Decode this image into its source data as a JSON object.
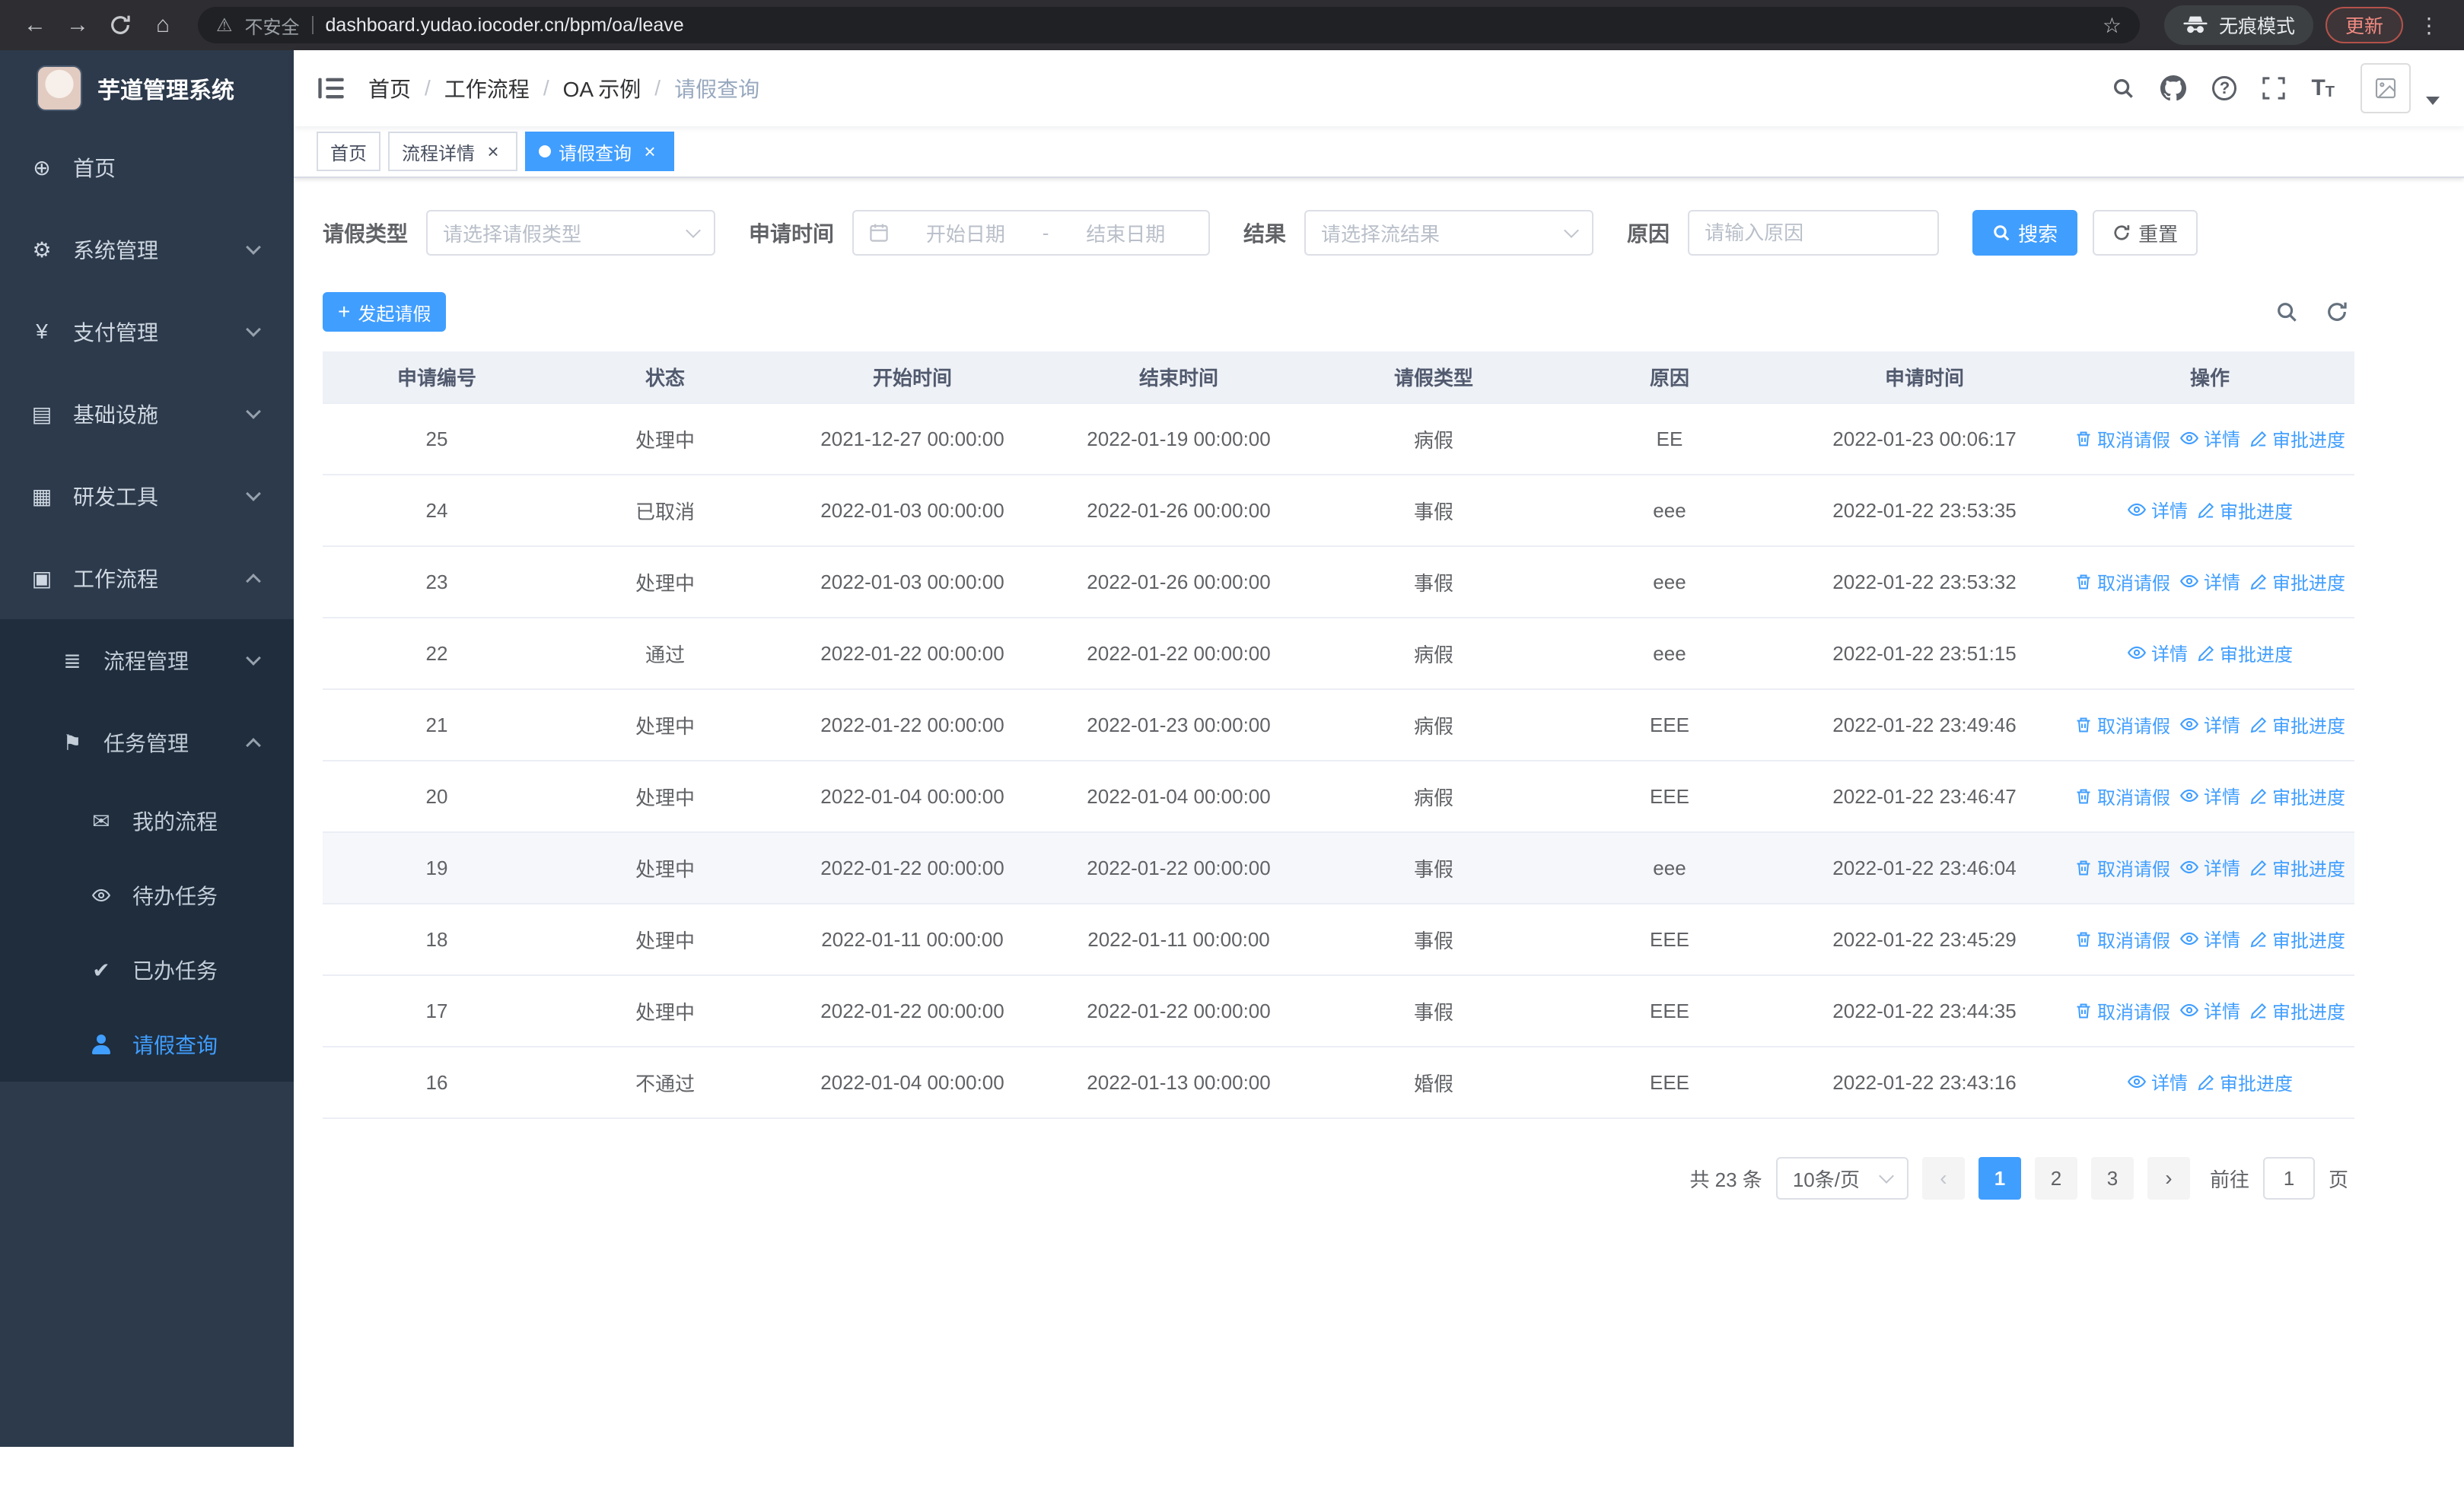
{
  "browser": {
    "security_label": "不安全",
    "url": "dashboard.yudao.iocoder.cn/bpm/oa/leave",
    "incognito_label": "无痕模式",
    "update_label": "更新"
  },
  "sidebar": {
    "logo_title": "芋道管理系统",
    "items": [
      {
        "key": "home",
        "label": "首页",
        "icon": "dashboard-icon",
        "level": 1,
        "chevron": null,
        "active": false
      },
      {
        "key": "system",
        "label": "系统管理",
        "icon": "gear-icon",
        "level": 1,
        "chevron": "down",
        "active": false
      },
      {
        "key": "payment",
        "label": "支付管理",
        "icon": "yen-icon",
        "level": 1,
        "chevron": "down",
        "active": false
      },
      {
        "key": "infra",
        "label": "基础设施",
        "icon": "infra-icon",
        "level": 1,
        "chevron": "down",
        "active": false
      },
      {
        "key": "devtools",
        "label": "研发工具",
        "icon": "tools-icon",
        "level": 1,
        "chevron": "down",
        "active": false
      },
      {
        "key": "workflow",
        "label": "工作流程",
        "icon": "workflow-icon",
        "level": 1,
        "chevron": "up",
        "active": false
      },
      {
        "key": "process-mgmt",
        "label": "流程管理",
        "icon": "process-icon",
        "level": 2,
        "chevron": "down",
        "active": false
      },
      {
        "key": "task-mgmt",
        "label": "任务管理",
        "icon": "flag-icon",
        "level": 2,
        "chevron": "up",
        "active": false
      },
      {
        "key": "my-process",
        "label": "我的流程",
        "icon": "chat-icon",
        "level": 3,
        "chevron": null,
        "active": false
      },
      {
        "key": "todo-tasks",
        "label": "待办任务",
        "icon": "eye-icon",
        "level": 3,
        "chevron": null,
        "active": false
      },
      {
        "key": "done-tasks",
        "label": "已办任务",
        "icon": "check-icon",
        "level": 3,
        "chevron": null,
        "active": false
      },
      {
        "key": "leave-query",
        "label": "请假查询",
        "icon": "person-icon",
        "level": 3,
        "chevron": null,
        "active": true
      }
    ]
  },
  "header": {
    "breadcrumb": [
      "首页",
      "工作流程",
      "OA 示例",
      "请假查询"
    ]
  },
  "tabs": [
    {
      "key": "home",
      "label": "首页",
      "closable": false,
      "active": false
    },
    {
      "key": "process-detail",
      "label": "流程详情",
      "closable": true,
      "active": false
    },
    {
      "key": "leave-query",
      "label": "请假查询",
      "closable": true,
      "active": true
    }
  ],
  "filters": {
    "leave_type_label": "请假类型",
    "leave_type_placeholder": "请选择请假类型",
    "apply_time_label": "申请时间",
    "start_date_placeholder": "开始日期",
    "date_separator": "-",
    "end_date_placeholder": "结束日期",
    "result_label": "结果",
    "result_placeholder": "请选择流结果",
    "reason_label": "原因",
    "reason_placeholder": "请输入原因",
    "search_button": "搜索",
    "reset_button": "重置"
  },
  "toolbar": {
    "create_button": "发起请假"
  },
  "table": {
    "columns": [
      "申请编号",
      "状态",
      "开始时间",
      "结束时间",
      "请假类型",
      "原因",
      "申请时间",
      "操作"
    ],
    "action_labels": {
      "cancel": "取消请假",
      "detail": "详情",
      "progress": "审批进度"
    },
    "rows": [
      {
        "id": "25",
        "status": "处理中",
        "start": "2021-12-27 00:00:00",
        "end": "2022-01-19 00:00:00",
        "type": "病假",
        "reason": "EE",
        "applied": "2022-01-23 00:06:17",
        "actions": [
          "cancel",
          "detail",
          "progress"
        ],
        "highlight": false
      },
      {
        "id": "24",
        "status": "已取消",
        "start": "2022-01-03 00:00:00",
        "end": "2022-01-26 00:00:00",
        "type": "事假",
        "reason": "eee",
        "applied": "2022-01-22 23:53:35",
        "actions": [
          "detail",
          "progress"
        ],
        "highlight": false
      },
      {
        "id": "23",
        "status": "处理中",
        "start": "2022-01-03 00:00:00",
        "end": "2022-01-26 00:00:00",
        "type": "事假",
        "reason": "eee",
        "applied": "2022-01-22 23:53:32",
        "actions": [
          "cancel",
          "detail",
          "progress"
        ],
        "highlight": false
      },
      {
        "id": "22",
        "status": "通过",
        "start": "2022-01-22 00:00:00",
        "end": "2022-01-22 00:00:00",
        "type": "病假",
        "reason": "eee",
        "applied": "2022-01-22 23:51:15",
        "actions": [
          "detail",
          "progress"
        ],
        "highlight": false
      },
      {
        "id": "21",
        "status": "处理中",
        "start": "2022-01-22 00:00:00",
        "end": "2022-01-23 00:00:00",
        "type": "病假",
        "reason": "EEE",
        "applied": "2022-01-22 23:49:46",
        "actions": [
          "cancel",
          "detail",
          "progress"
        ],
        "highlight": false
      },
      {
        "id": "20",
        "status": "处理中",
        "start": "2022-01-04 00:00:00",
        "end": "2022-01-04 00:00:00",
        "type": "病假",
        "reason": "EEE",
        "applied": "2022-01-22 23:46:47",
        "actions": [
          "cancel",
          "detail",
          "progress"
        ],
        "highlight": false
      },
      {
        "id": "19",
        "status": "处理中",
        "start": "2022-01-22 00:00:00",
        "end": "2022-01-22 00:00:00",
        "type": "事假",
        "reason": "eee",
        "applied": "2022-01-22 23:46:04",
        "actions": [
          "cancel",
          "detail",
          "progress"
        ],
        "highlight": true
      },
      {
        "id": "18",
        "status": "处理中",
        "start": "2022-01-11 00:00:00",
        "end": "2022-01-11 00:00:00",
        "type": "事假",
        "reason": "EEE",
        "applied": "2022-01-22 23:45:29",
        "actions": [
          "cancel",
          "detail",
          "progress"
        ],
        "highlight": false
      },
      {
        "id": "17",
        "status": "处理中",
        "start": "2022-01-22 00:00:00",
        "end": "2022-01-22 00:00:00",
        "type": "事假",
        "reason": "EEE",
        "applied": "2022-01-22 23:44:35",
        "actions": [
          "cancel",
          "detail",
          "progress"
        ],
        "highlight": false
      },
      {
        "id": "16",
        "status": "不通过",
        "start": "2022-01-04 00:00:00",
        "end": "2022-01-13 00:00:00",
        "type": "婚假",
        "reason": "EEE",
        "applied": "2022-01-22 23:43:16",
        "actions": [
          "detail",
          "progress"
        ],
        "highlight": false
      }
    ]
  },
  "pagination": {
    "total_label": "共 23 条",
    "page_size": "10条/页",
    "pages": [
      "1",
      "2",
      "3"
    ],
    "active_page": "1",
    "goto_label": "前往",
    "goto_value": "1",
    "goto_suffix": "页"
  },
  "colors": {
    "accent": "#409eff",
    "sidebar_bg": "#2d3a4b",
    "submenu_bg": "#1f2d3d",
    "table_header_bg": "#eef1f6"
  }
}
